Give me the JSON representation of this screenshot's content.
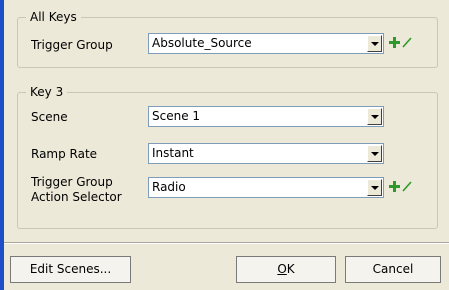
{
  "all_keys": {
    "legend": "All Keys",
    "trigger_group_label": "Trigger Group",
    "trigger_group_value": "Absolute_Source"
  },
  "key3": {
    "legend": "Key 3",
    "scene_label": "Scene",
    "scene_value": "Scene 1",
    "ramp_rate_label": "Ramp Rate",
    "ramp_rate_value": "Instant",
    "tg_action_label_line1": "Trigger Group",
    "tg_action_label_line2": "Action Selector",
    "tg_action_value": "Radio"
  },
  "buttons": {
    "edit_scenes": "Edit Scenes...",
    "ok_mnemonic": "O",
    "ok_rest": "K",
    "cancel": "Cancel"
  },
  "colors": {
    "window_bg": "#ece9d8",
    "left_accent": "#1f4fc8",
    "add_icon": "#2e9a2e",
    "edit_icon": "#2e9a2e"
  },
  "icons": [
    "add-icon",
    "edit-icon",
    "dropdown-arrow-icon"
  ]
}
